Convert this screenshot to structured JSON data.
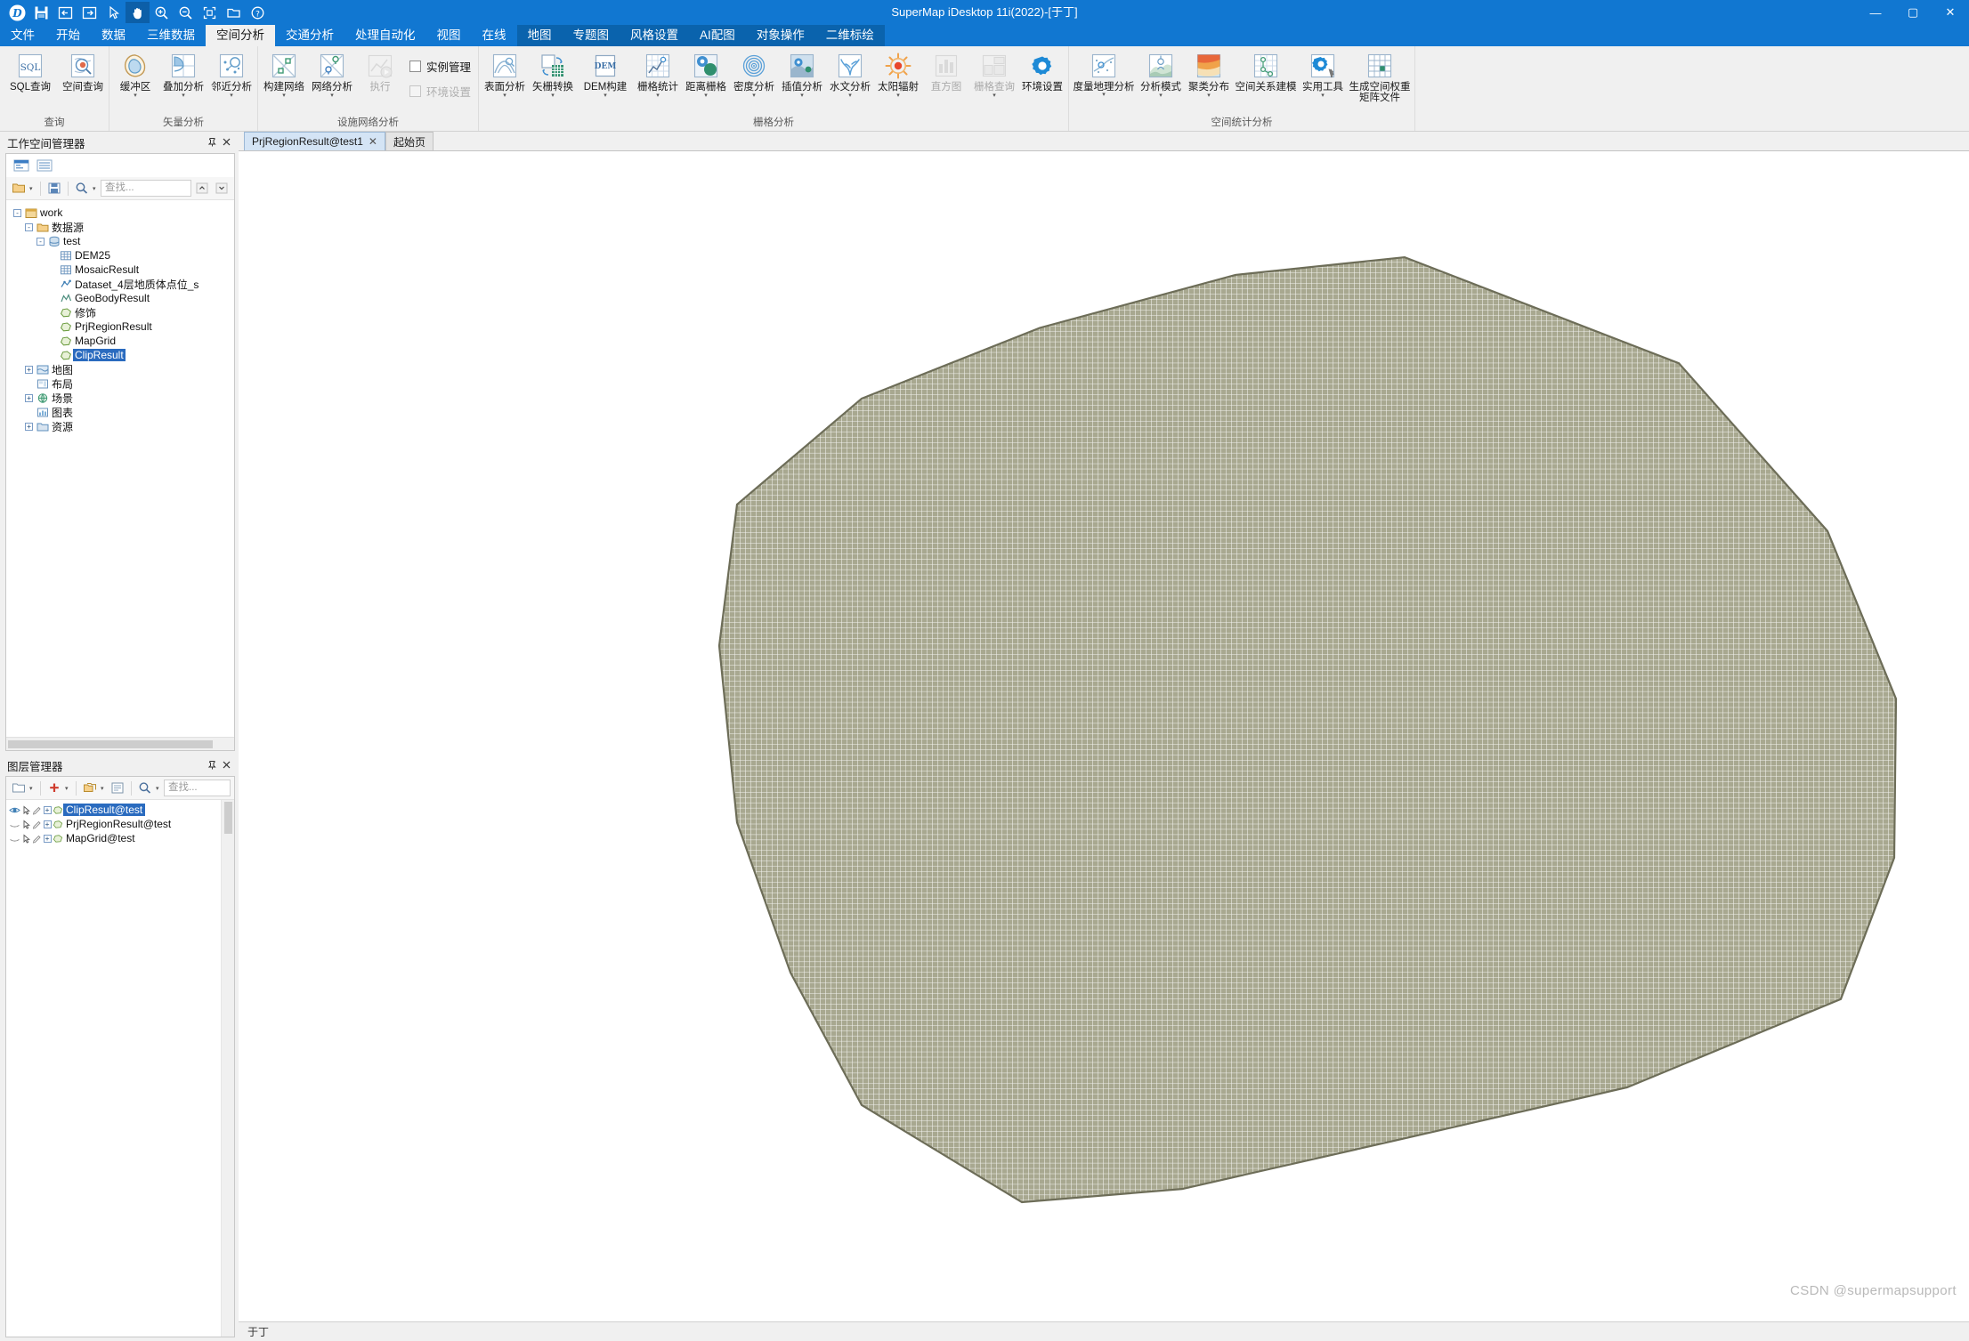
{
  "window": {
    "title": "SuperMap iDesktop 11i(2022)-[于丁]",
    "min_label": "—",
    "max_label": "▢",
    "close_label": "✕"
  },
  "quick_access": [
    {
      "name": "app-logo-icon",
      "label": "SuperMap"
    },
    {
      "name": "save-icon",
      "label": "保存"
    },
    {
      "name": "undo-icon",
      "label": "撤销"
    },
    {
      "name": "redo-icon",
      "label": "恢复"
    },
    {
      "name": "select-arrow-icon",
      "label": "选择"
    },
    {
      "name": "pan-hand-icon",
      "label": "漫游"
    },
    {
      "name": "zoom-in-icon",
      "label": "放大"
    },
    {
      "name": "zoom-out-icon",
      "label": "缩小"
    },
    {
      "name": "full-extent-icon",
      "label": "全幅显示"
    },
    {
      "name": "open-folder-icon",
      "label": "打开"
    },
    {
      "name": "help-icon",
      "label": "帮助"
    }
  ],
  "tabs": [
    {
      "label": "文件",
      "active": false,
      "group": false
    },
    {
      "label": "开始",
      "active": false,
      "group": false
    },
    {
      "label": "数据",
      "active": false,
      "group": false
    },
    {
      "label": "三维数据",
      "active": false,
      "group": false
    },
    {
      "label": "空间分析",
      "active": true,
      "group": false
    },
    {
      "label": "交通分析",
      "active": false,
      "group": false
    },
    {
      "label": "处理自动化",
      "active": false,
      "group": false
    },
    {
      "label": "视图",
      "active": false,
      "group": false
    },
    {
      "label": "在线",
      "active": false,
      "group": false
    },
    {
      "label": "地图",
      "active": false,
      "group": true
    },
    {
      "label": "专题图",
      "active": false,
      "group": true
    },
    {
      "label": "风格设置",
      "active": false,
      "group": true
    },
    {
      "label": "AI配图",
      "active": false,
      "group": true
    },
    {
      "label": "对象操作",
      "active": false,
      "group": true
    },
    {
      "label": "二维标绘",
      "active": false,
      "group": true
    }
  ],
  "ribbon": {
    "groups": [
      {
        "title": "查询",
        "items": [
          {
            "label": "SQL查询",
            "icon": "sql-query-icon",
            "disabled": false,
            "caret": false
          },
          {
            "label": "空间查询",
            "icon": "spatial-query-icon",
            "disabled": false,
            "caret": false
          }
        ]
      },
      {
        "title": "矢量分析",
        "items": [
          {
            "label": "缓冲区",
            "icon": "buffer-icon",
            "disabled": false,
            "caret": true
          },
          {
            "label": "叠加分析",
            "icon": "overlay-icon",
            "disabled": false,
            "caret": true
          },
          {
            "label": "邻近分析",
            "icon": "proximity-icon",
            "disabled": false,
            "caret": true
          }
        ]
      },
      {
        "title": "设施网络分析",
        "items": [
          {
            "label": "构建网络",
            "icon": "build-network-icon",
            "disabled": false,
            "caret": true
          },
          {
            "label": "网络分析",
            "icon": "network-analysis-icon",
            "disabled": false,
            "caret": true
          },
          {
            "label": "执行",
            "icon": "execute-icon",
            "disabled": true,
            "caret": false
          }
        ],
        "checkboxes": [
          {
            "label": "实例管理",
            "checked": false,
            "disabled": false
          },
          {
            "label": "环境设置",
            "checked": false,
            "disabled": true
          }
        ]
      },
      {
        "title": "栅格分析",
        "items": [
          {
            "label": "表面分析",
            "icon": "surface-analysis-icon",
            "disabled": false,
            "caret": true
          },
          {
            "label": "矢栅转换",
            "icon": "vector-raster-icon",
            "disabled": false,
            "caret": true
          },
          {
            "label": "DEM构建",
            "icon": "dem-build-icon",
            "disabled": false,
            "caret": true
          },
          {
            "label": "栅格统计",
            "icon": "raster-statistics-icon",
            "disabled": false,
            "caret": true
          },
          {
            "label": "距离栅格",
            "icon": "distance-raster-icon",
            "disabled": false,
            "caret": true
          },
          {
            "label": "密度分析",
            "icon": "density-analysis-icon",
            "disabled": false,
            "caret": true
          },
          {
            "label": "插值分析",
            "icon": "interpolation-icon",
            "disabled": false,
            "caret": true
          },
          {
            "label": "水文分析",
            "icon": "hydrology-icon",
            "disabled": false,
            "caret": true
          },
          {
            "label": "太阳辐射",
            "icon": "solar-radiation-icon",
            "disabled": false,
            "caret": true
          },
          {
            "label": "直方图",
            "icon": "histogram-icon",
            "disabled": true,
            "caret": false
          },
          {
            "label": "栅格查询",
            "icon": "raster-query-icon",
            "disabled": true,
            "caret": true
          },
          {
            "label": "环境设置",
            "icon": "env-settings-icon",
            "disabled": false,
            "caret": false
          }
        ]
      },
      {
        "title": "空间统计分析",
        "items": [
          {
            "label": "度量地理分析",
            "icon": "geo-measure-icon",
            "disabled": false,
            "caret": true
          },
          {
            "label": "分析模式",
            "icon": "analysis-pattern-icon",
            "disabled": false,
            "caret": true
          },
          {
            "label": "聚类分布",
            "icon": "cluster-distribution-icon",
            "disabled": false,
            "caret": true
          },
          {
            "label": "空间关系建模",
            "icon": "spatial-relation-model-icon",
            "disabled": false,
            "caret": false
          },
          {
            "label": "实用工具",
            "icon": "utilities-icon",
            "disabled": false,
            "caret": true
          },
          {
            "label": "生成空间权重矩阵文件",
            "icon": "spatial-weight-matrix-icon",
            "disabled": false,
            "caret": false
          }
        ]
      }
    ]
  },
  "workspace_panel": {
    "title": "工作空间管理器",
    "pin": "📌",
    "close": "✕",
    "search_placeholder": "查找...",
    "tree": [
      {
        "depth": 0,
        "label": "work",
        "icon": "workspace-icon",
        "expander": "-",
        "selected": false
      },
      {
        "depth": 1,
        "label": "数据源",
        "icon": "datasource-folder-icon",
        "expander": "-",
        "selected": false
      },
      {
        "depth": 2,
        "label": "test",
        "icon": "datasource-icon",
        "expander": "-",
        "selected": false
      },
      {
        "depth": 3,
        "label": "DEM25",
        "icon": "raster-dataset-icon",
        "expander": "",
        "selected": false
      },
      {
        "depth": 3,
        "label": "MosaicResult",
        "icon": "raster-dataset-icon",
        "expander": "",
        "selected": false
      },
      {
        "depth": 3,
        "label": "Dataset_4层地质体点位_s",
        "icon": "point-dataset-icon",
        "expander": "",
        "selected": false
      },
      {
        "depth": 3,
        "label": "GeoBodyResult",
        "icon": "model-dataset-icon",
        "expander": "",
        "selected": false
      },
      {
        "depth": 3,
        "label": "修饰",
        "icon": "region-dataset-icon",
        "expander": "",
        "selected": false
      },
      {
        "depth": 3,
        "label": "PrjRegionResult",
        "icon": "region-dataset-icon",
        "expander": "",
        "selected": false
      },
      {
        "depth": 3,
        "label": "MapGrid",
        "icon": "region-dataset-icon",
        "expander": "",
        "selected": false
      },
      {
        "depth": 3,
        "label": "ClipResult",
        "icon": "region-dataset-icon",
        "expander": "",
        "selected": true
      },
      {
        "depth": 1,
        "label": "地图",
        "icon": "map-folder-icon",
        "expander": "+",
        "selected": false
      },
      {
        "depth": 1,
        "label": "布局",
        "icon": "layout-folder-icon",
        "expander": "",
        "selected": false
      },
      {
        "depth": 1,
        "label": "场景",
        "icon": "scene-folder-icon",
        "expander": "+",
        "selected": false
      },
      {
        "depth": 1,
        "label": "图表",
        "icon": "chart-folder-icon",
        "expander": "",
        "selected": false
      },
      {
        "depth": 1,
        "label": "资源",
        "icon": "resource-folder-icon",
        "expander": "+",
        "selected": false
      }
    ]
  },
  "layer_panel": {
    "title": "图层管理器",
    "pin": "📌",
    "close": "✕",
    "search_placeholder": "查找...",
    "layers": [
      {
        "name": "ClipResult@test",
        "visible": true,
        "selected": true
      },
      {
        "name": "PrjRegionResult@test",
        "visible": false,
        "selected": false
      },
      {
        "name": "MapGrid@test",
        "visible": false,
        "selected": false
      }
    ]
  },
  "doc_tabs": [
    {
      "label": "PrjRegionResult@test1",
      "active": true,
      "closable": true
    },
    {
      "label": "起始页",
      "active": false,
      "closable": false
    }
  ],
  "status": {
    "left_text": "于丁"
  },
  "watermark": "CSDN @supermapsupport",
  "map": {
    "fill_color": "#a7a78f",
    "grid_color": "#ffffff",
    "outline_color": "#7f7f6a",
    "background": "#ffffff"
  }
}
